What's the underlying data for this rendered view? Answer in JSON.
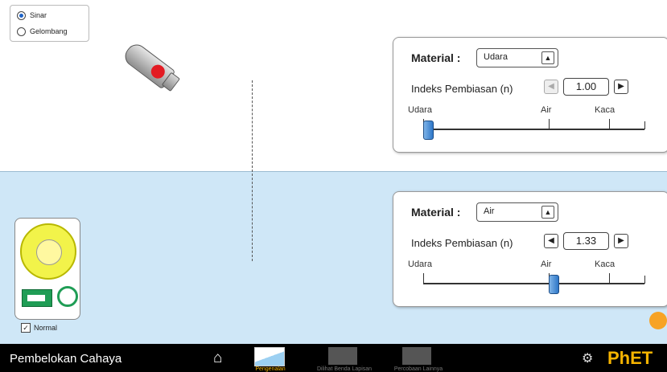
{
  "mode": {
    "options": [
      "Sinar",
      "Gelombang"
    ],
    "selected": "Sinar"
  },
  "top_panel": {
    "material_label": "Material :",
    "material_value": "Udara",
    "index_label": "Indeks Pembiasan (n)",
    "index_value": "1.00",
    "slider_ticks": [
      "Udara",
      "Air",
      "Kaca"
    ],
    "slider_level": 0.0
  },
  "bottom_panel": {
    "material_label": "Material :",
    "material_value": "Air",
    "index_label": "Indeks Pembiasan (n)",
    "index_value": "1.33",
    "slider_ticks": [
      "Udara",
      "Air",
      "Kaca"
    ],
    "slider_level": 0.57
  },
  "normal_checkbox": {
    "label": "Normal",
    "checked": true
  },
  "navbar": {
    "title": "Pembelokan Cahaya",
    "screens": [
      {
        "label": "Pengenalan",
        "active": true
      },
      {
        "label": "Dilihat Benda Lapisan",
        "active": false
      },
      {
        "label": "Percobaan Lainnya",
        "active": false
      }
    ],
    "brand": "PhET"
  },
  "colors": {
    "lower_medium": "#cfe7f7",
    "laser_red": "#e31b23",
    "navbar": "#000000",
    "accent": "#f7a325"
  }
}
